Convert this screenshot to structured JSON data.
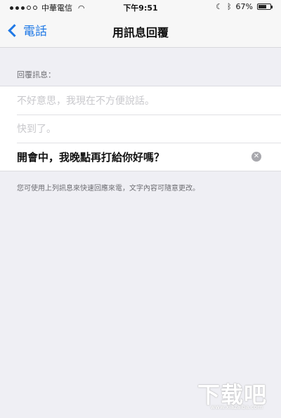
{
  "status_bar": {
    "carrier": "中華電信",
    "time": "下午9:51",
    "battery": "67%",
    "battery_level": 0.67
  },
  "nav": {
    "back_label": "電話",
    "title": "用訊息回覆"
  },
  "section": {
    "header": "回覆訊息："
  },
  "responses": [
    {
      "placeholder": "不好意思，我現在不方便說話。"
    },
    {
      "placeholder": "快到了。"
    },
    {
      "value": "開會中，我晚點再打給你好嗎？"
    }
  ],
  "footer_note": "您可使用上列訊息來快速回應來電，文字內容可隨意更改。",
  "watermark": {
    "text": "下载吧",
    "url": "www.xiazaiba.com"
  }
}
